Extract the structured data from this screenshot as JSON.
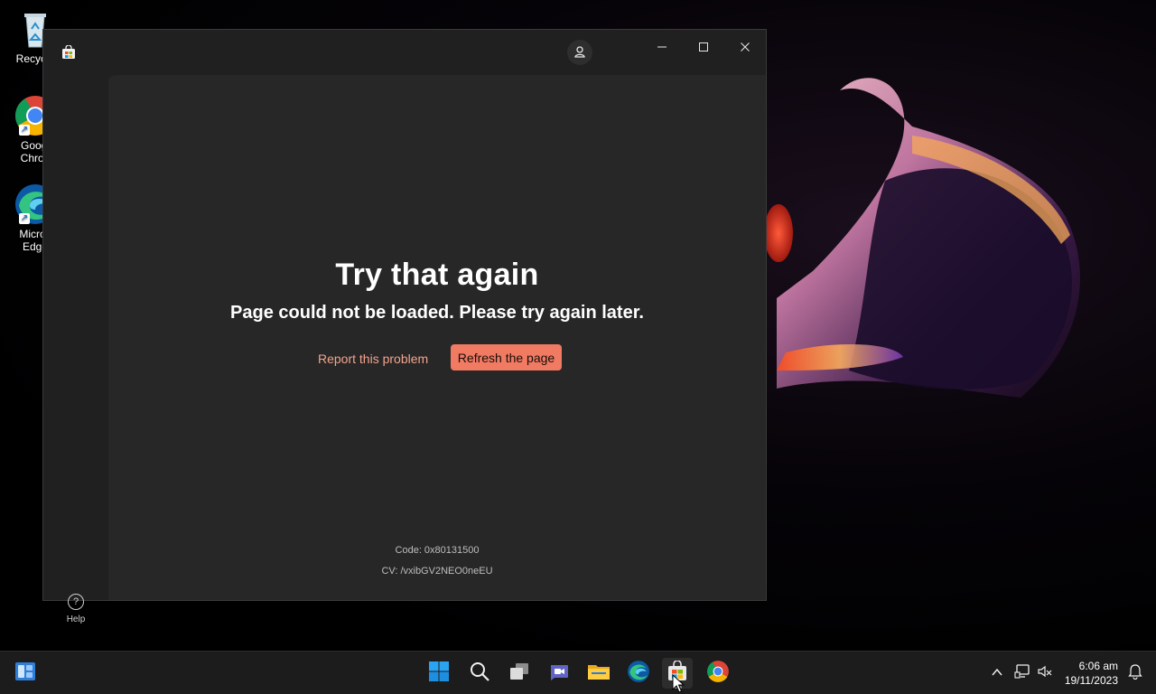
{
  "desktop": {
    "icons": [
      {
        "label": "Recycle",
        "icon": "recycle-bin-icon"
      },
      {
        "label": "Googl\nChron",
        "label_line1": "Googl",
        "label_line2": "Chron",
        "icon": "chrome-icon"
      },
      {
        "label_line1": "Micros",
        "label_line2": "Edge",
        "icon": "edge-icon"
      }
    ]
  },
  "window": {
    "app_icon": "microsoft-store-icon",
    "account_icon": "account-icon",
    "controls": {
      "minimize_icon": "minimize-icon",
      "maximize_icon": "maximize-icon",
      "close_icon": "close-icon"
    },
    "sidebar": {
      "help_label": "Help",
      "help_icon": "help-icon"
    },
    "error": {
      "title": "Try that again",
      "message": "Page could not be loaded. Please try again later.",
      "report_link": "Report this problem",
      "refresh_button": "Refresh the page",
      "code": "Code: 0x80131500",
      "cv": "CV: /vxibGV2NEO0neEU"
    }
  },
  "taskbar": {
    "items": [
      {
        "name": "start-button",
        "icon": "windows-logo-icon"
      },
      {
        "name": "search",
        "icon": "search-icon"
      },
      {
        "name": "task-view",
        "icon": "task-view-icon"
      },
      {
        "name": "teams-chat",
        "icon": "chat-icon"
      },
      {
        "name": "file-explorer",
        "icon": "folder-icon"
      },
      {
        "name": "edge",
        "icon": "edge-icon"
      },
      {
        "name": "microsoft-store",
        "icon": "store-icon",
        "active": true
      },
      {
        "name": "chrome",
        "icon": "chrome-icon"
      }
    ],
    "tray": {
      "chevron_icon": "chevron-up-icon",
      "network_icon": "network-icon",
      "volume_icon": "volume-muted-icon",
      "notification_icon": "notification-icon"
    },
    "clock": {
      "time": "6:06 am",
      "date": "19/11/2023"
    }
  }
}
